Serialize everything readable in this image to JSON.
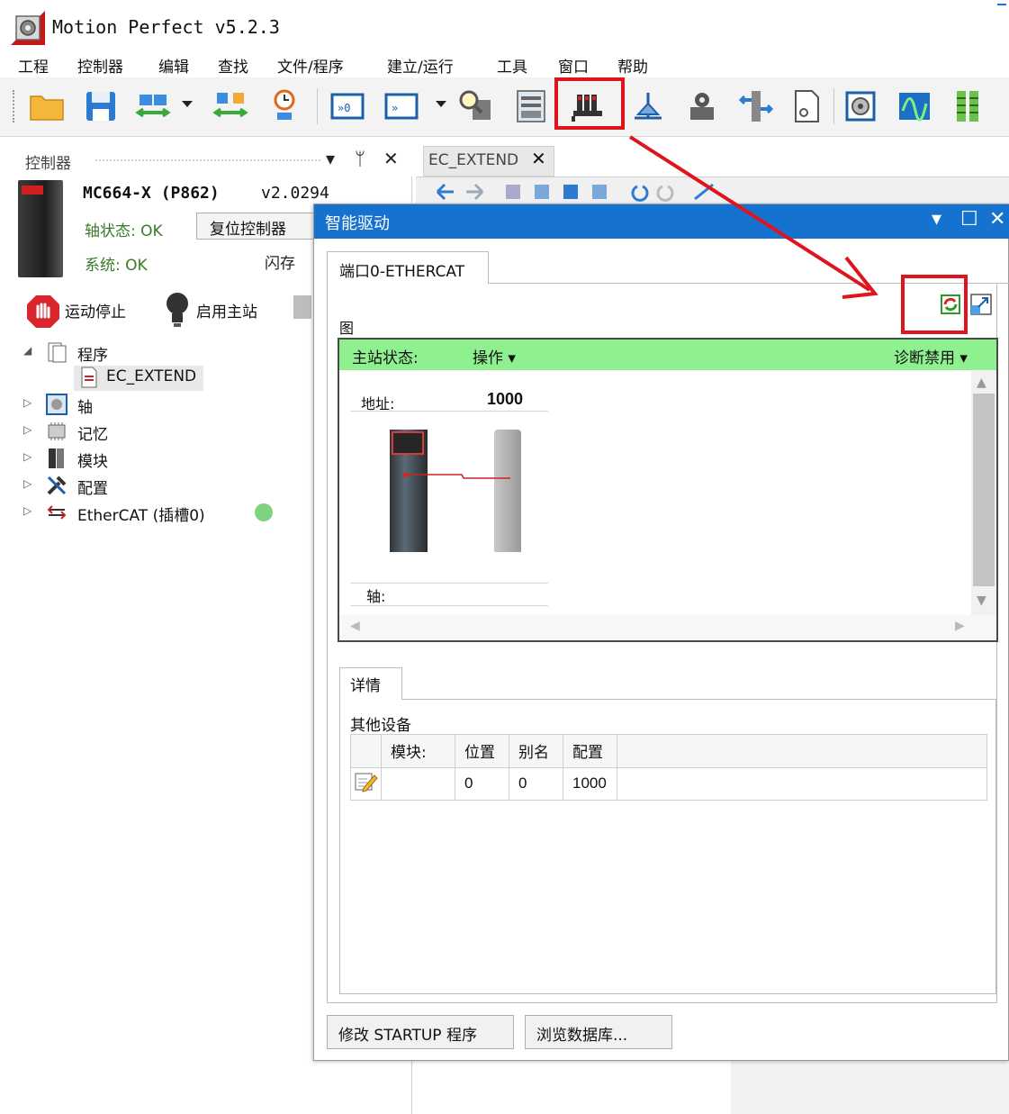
{
  "window": {
    "title": "Motion Perfect v5.2.3"
  },
  "menu": [
    "工程",
    "控制器",
    "编辑",
    "查找",
    "文件/程序",
    "建立/运行",
    "工具",
    "窗口",
    "帮助"
  ],
  "toolbar_icons": [
    "open-folder-icon",
    "save-icon",
    "connect-icon",
    "disconnect-icon",
    "clock-icon",
    "terminal-icon",
    "terminal2-icon",
    "search-tool-icon",
    "memory-icon",
    "intelligent-drive-icon",
    "axis-tool-icon",
    "robot-icon",
    "network-icon",
    "document-icon",
    "axis-config-icon",
    "scope-icon",
    "io-icon"
  ],
  "left_panel": {
    "title": "控制器",
    "controller_name": "MC664-X  (P862)",
    "controller_version": "v2.0294",
    "axis_status": "轴状态: OK",
    "reset_button": "复位控制器",
    "system_status": "系统: OK",
    "flash_label": "闪存",
    "motion_stop": "运动停止",
    "enable_master": "启用主站",
    "tree": {
      "program": "程序",
      "program_child": "EC_EXTEND",
      "axis": "轴",
      "memory": "记忆",
      "module": "模块",
      "config": "配置",
      "ethercat": "EtherCAT (插槽0)"
    },
    "status_color": "#7ed37e"
  },
  "editor": {
    "tab_label": "EC_EXTEND"
  },
  "dialog": {
    "title": "智能驱动",
    "port_tab": "端口0-ETHERCAT",
    "diagram_label": "图",
    "master_status_label": "主站状态:",
    "operation": "操作",
    "diagnostics": "诊断禁用",
    "address_label": "地址:",
    "address_value": "1000",
    "axis_label": "轴:",
    "details_tab": "详情",
    "other_devices": "其他设备",
    "table": {
      "headers": [
        "",
        "模块:",
        "位置",
        "别名",
        "配置"
      ],
      "rows": [
        {
          "module": "",
          "position": "0",
          "alias": "0",
          "config": "1000"
        }
      ]
    },
    "btn_startup": "修改 STARTUP 程序",
    "btn_browse": "浏览数据库..."
  },
  "colors": {
    "title_bar": "#1672cf",
    "master_bar": "#8ef08e",
    "highlight": "#e0141c"
  }
}
